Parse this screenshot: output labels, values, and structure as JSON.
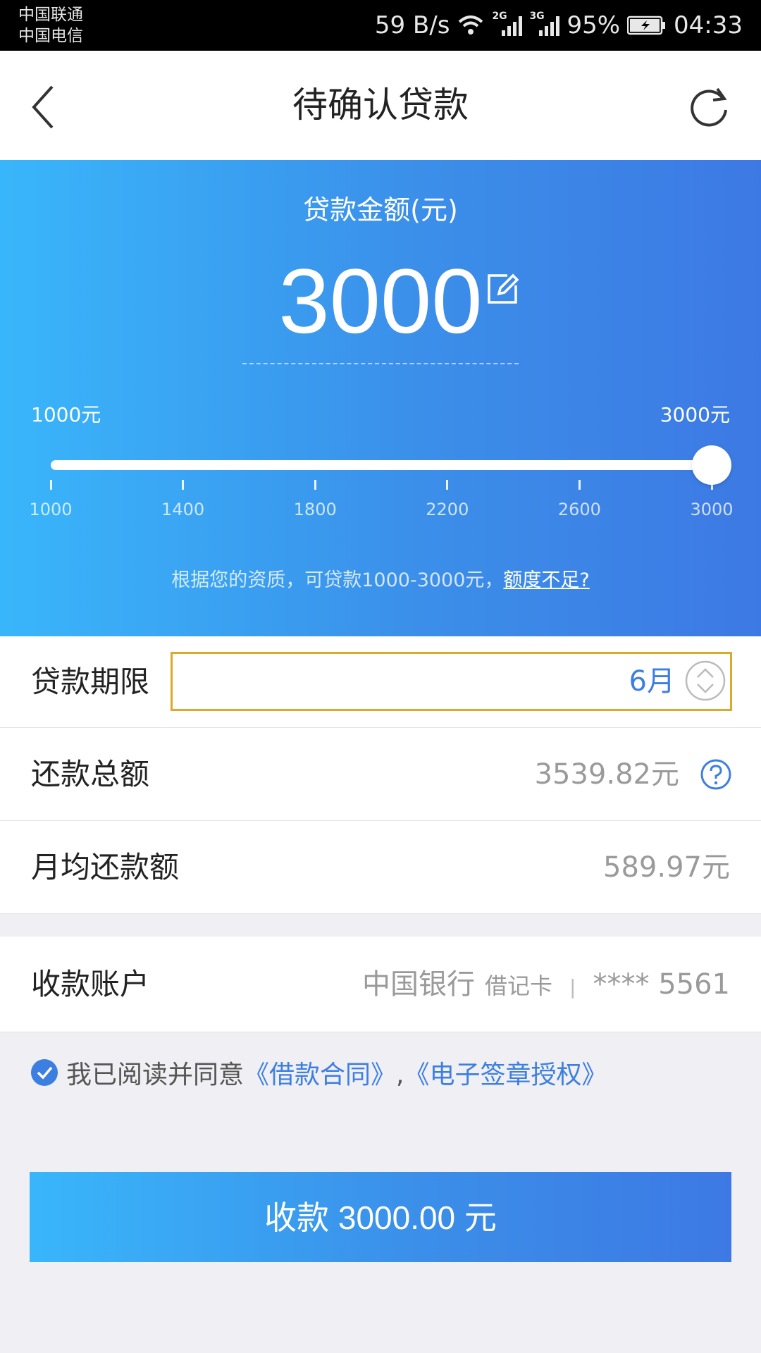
{
  "status_bar": {
    "carrier1": "中国联通",
    "carrier2": "中国电信",
    "speed": "59 B/s",
    "net1": "2G",
    "net2": "3G",
    "battery": "95%",
    "time": "04:33"
  },
  "nav": {
    "title": "待确认贷款"
  },
  "hero": {
    "label": "贷款金额(元)",
    "amount": "3000",
    "min_label": "1000元",
    "max_label": "3000元",
    "slider": {
      "min": 1000,
      "max": 3000,
      "value": 3000
    },
    "ticks": [
      "1000",
      "1400",
      "1800",
      "2200",
      "2600",
      "3000"
    ],
    "hint": "根据您的资质，可贷款1000-3000元，",
    "hint_link": "额度不足?"
  },
  "term": {
    "label": "贷款期限",
    "value": "6月"
  },
  "total": {
    "label": "还款总额",
    "value": "3539.82元"
  },
  "monthly": {
    "label": "月均还款额",
    "value": "589.97元"
  },
  "account": {
    "label": "收款账户",
    "bank": "中国银行",
    "card_type": "借记卡",
    "separator": "|",
    "number": "**** 5561"
  },
  "agreement": {
    "prefix": "我已阅读并同意",
    "contract": "《借款合同》",
    "comma": ",",
    "auth": "《电子签章授权》"
  },
  "submit": {
    "label": "收款 3000.00 元"
  },
  "colors": {
    "accent": "#3d7fe0",
    "highlight_border": "#dcaa2b"
  }
}
